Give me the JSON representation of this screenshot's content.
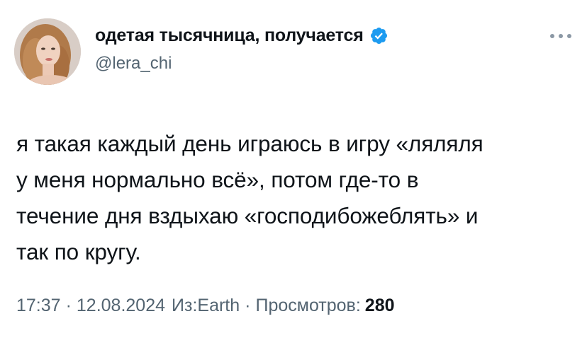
{
  "author": {
    "display_name": "одетая тысячница, получается",
    "handle": "@lera_chi",
    "verified": true
  },
  "tweet": {
    "text": "я такая каждый день играюсь в игру «ляляля\nу меня нормально всё», потом где-то в\nтечение дня вздыхаю «господибожеблять» и\nтак по кругу."
  },
  "meta": {
    "time": "17:37",
    "separator": "·",
    "date": "12.08.2024",
    "source": "Из:Earth",
    "views_label": "Просмотров:",
    "views_count": "280"
  },
  "icons": {
    "verified": "verified-badge-icon",
    "more": "more-options-icon"
  },
  "colors": {
    "verified_blue": "#1d9bf0",
    "secondary_text": "#536471",
    "primary_text": "#0f1419"
  }
}
